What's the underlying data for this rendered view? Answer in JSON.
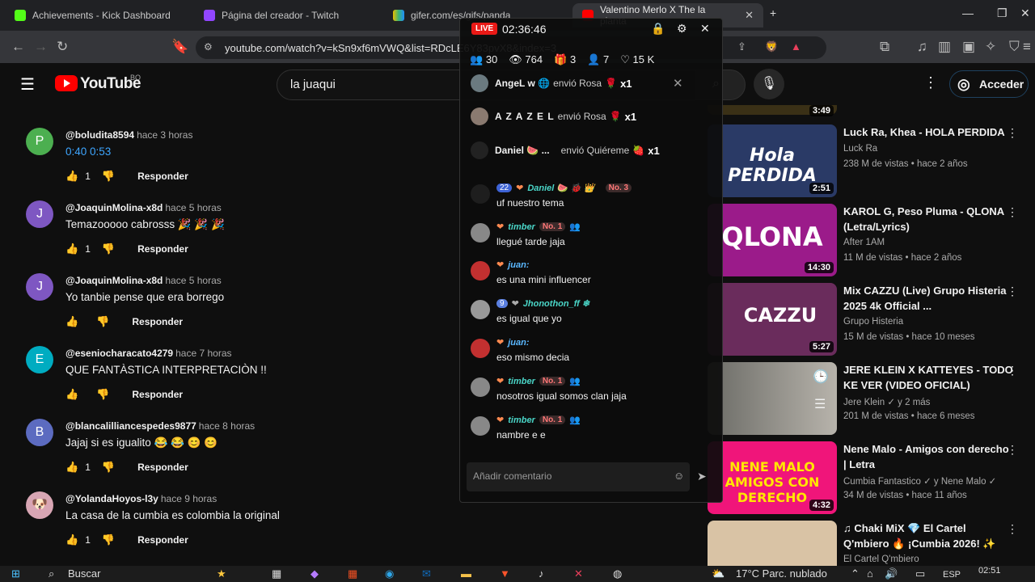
{
  "browser": {
    "tabs": [
      {
        "title": "Achievements - Kick Dashboard",
        "color": "#53fc18"
      },
      {
        "title": "Página del creador - Twitch",
        "color": "#9146ff"
      },
      {
        "title": "gifer.com/es/gifs/panda",
        "color": "#e8c000"
      },
      {
        "title": "Valentino Merlo X The la planta",
        "color": "#ff0000"
      }
    ],
    "url": "youtube.com/watch?v=kSn9xf6mVWQ&list=RDcLE6Y83pvX8&index=3"
  },
  "youtube": {
    "logo_text": "YouTube",
    "region": "BO",
    "search_value": "la  juaqui",
    "signin_label": "Acceder"
  },
  "comments": [
    {
      "initial": "P",
      "avatar_color": "#4caf50",
      "user": "@boludita8594",
      "time": "hace 3 horas",
      "text": "0:40 0:53",
      "is_link": true,
      "likes": "1",
      "reply": "Responder"
    },
    {
      "initial": "J",
      "avatar_color": "#7e57c2",
      "user": "@JoaquinMolina-x8d",
      "time": "hace 5 horas",
      "text": "Temazooooo cabrosss 🎉 🎉 🎉",
      "is_link": false,
      "likes": "1",
      "reply": "Responder"
    },
    {
      "initial": "J",
      "avatar_color": "#7e57c2",
      "user": "@JoaquinMolina-x8d",
      "time": "hace 5 horas",
      "text": "Yo tanbie pense que era borrego",
      "is_link": false,
      "likes": "",
      "reply": "Responder"
    },
    {
      "initial": "E",
      "avatar_color": "#00acc1",
      "user": "@eseniocharacato4279",
      "time": "hace 7 horas",
      "text": "QUE FANTÀSTICA INTERPRETACIÒN !!",
      "is_link": false,
      "likes": "",
      "reply": "Responder"
    },
    {
      "initial": "B",
      "avatar_color": "#5c6bc0",
      "user": "@blancalilliancespedes9877",
      "time": "hace 8 horas",
      "text": "Jajaj si es igualito 😂 😂 😊 😊",
      "is_link": false,
      "likes": "1",
      "reply": "Responder"
    },
    {
      "initial": "",
      "avatar_color": "#d8a6b4",
      "user": "@YolandaHoyos-l3y",
      "time": "hace 9 horas",
      "text": "La casa de la cumbia es colombia la original",
      "is_link": false,
      "likes": "1",
      "reply": "Responder"
    }
  ],
  "videos": [
    {
      "title": "Luck Ra, Khea - HOLA PERDIDA",
      "channel": "Luck Ra",
      "meta": "238 M de vistas • hace 2 años",
      "duration": "2:51",
      "thumb_text": "Hola PERDIDA",
      "thumb_bg": "#2a3a66"
    },
    {
      "title": "KAROL G, Peso Pluma - QLONA (Letra/Lyrics)",
      "channel": "After 1AM",
      "meta": "11 M de vistas • hace 2 años",
      "duration": "14:30",
      "thumb_text": "QLONA",
      "thumb_bg": "#9b1b8a"
    },
    {
      "title": "Mix CAZZU (Live) Grupo Histeria 2025 4k Official ...",
      "channel": "Grupo Histeria",
      "meta": "15 M de vistas • hace 10 meses",
      "duration": "5:27",
      "thumb_text": "CAZZU",
      "thumb_bg": "#6a2c5c"
    },
    {
      "title": "JERE KLEIN X KATTEYES - TODO KE VER (VIDEO OFICIAL)",
      "channel": "Jere Klein ✓ y 2 más",
      "meta": "201 M de vistas • hace 6 meses",
      "duration": "",
      "thumb_text": "",
      "thumb_bg": "#8a8a84"
    },
    {
      "title": "Nene Malo - Amigos con derecho | Letra",
      "channel": "Cumbia Fantastico ✓ y Nene Malo ✓",
      "meta": "34 M de vistas • hace 11 años",
      "duration": "4:32",
      "thumb_text": "NENE MALO AMIGOS CON DERECHO",
      "thumb_bg": "#f0157a"
    },
    {
      "title": "♫ Chaki MiX 💎 El Cartel Q'mbiero 🔥 ¡Cumbia 2026! ✨",
      "channel": "El Cartel Q'mbiero",
      "meta": "",
      "duration": "",
      "thumb_text": "",
      "thumb_bg": "#d9c3a5"
    }
  ],
  "prev_video_duration": "3:49",
  "live": {
    "badge": "LIVE",
    "timer": "02:36:46",
    "stats": {
      "members": "30",
      "viewers": "764",
      "gifts": "3",
      "follows": "7",
      "likes": "15 K"
    },
    "gifts": [
      {
        "who": "AngeL w 🌐",
        "action": "envió Rosa",
        "item": "🌹",
        "mult": "x1"
      },
      {
        "who": "A Z A Z E L",
        "action": "envió Rosa",
        "item": "🌹",
        "mult": "x1"
      },
      {
        "who": "Daniel 🍉 ...",
        "action": "envió Quiéreme",
        "item": "🍓",
        "mult": "x1"
      }
    ],
    "messages": [
      {
        "badges": "22",
        "nick": "Daniel 🍉 🐞 👑",
        "rank": "No. 3",
        "text": "uf nuestro tema"
      },
      {
        "badges": "",
        "nick": "timber",
        "rank": "No. 1",
        "text": "llegué tarde jaja"
      },
      {
        "badges": "",
        "nick": "juan:",
        "rank": "",
        "text": "es una mini influencer"
      },
      {
        "badges": "9",
        "nick": "Jhonothon_ff ❄",
        "rank": "",
        "text": "es igual que yo"
      },
      {
        "badges": "",
        "nick": "juan:",
        "rank": "",
        "text": "eso mismo decia"
      },
      {
        "badges": "",
        "nick": "timber",
        "rank": "No. 1",
        "text": "nosotros igual somos clan jaja"
      },
      {
        "badges": "",
        "nick": "timber",
        "rank": "No. 1",
        "text": "nambre e e"
      }
    ],
    "comment_placeholder": "Añadir comentario"
  },
  "taskbar": {
    "search_label": "Buscar",
    "weather": "17°C  Parc. nublado",
    "lang": "ESP",
    "time": "02:51"
  }
}
